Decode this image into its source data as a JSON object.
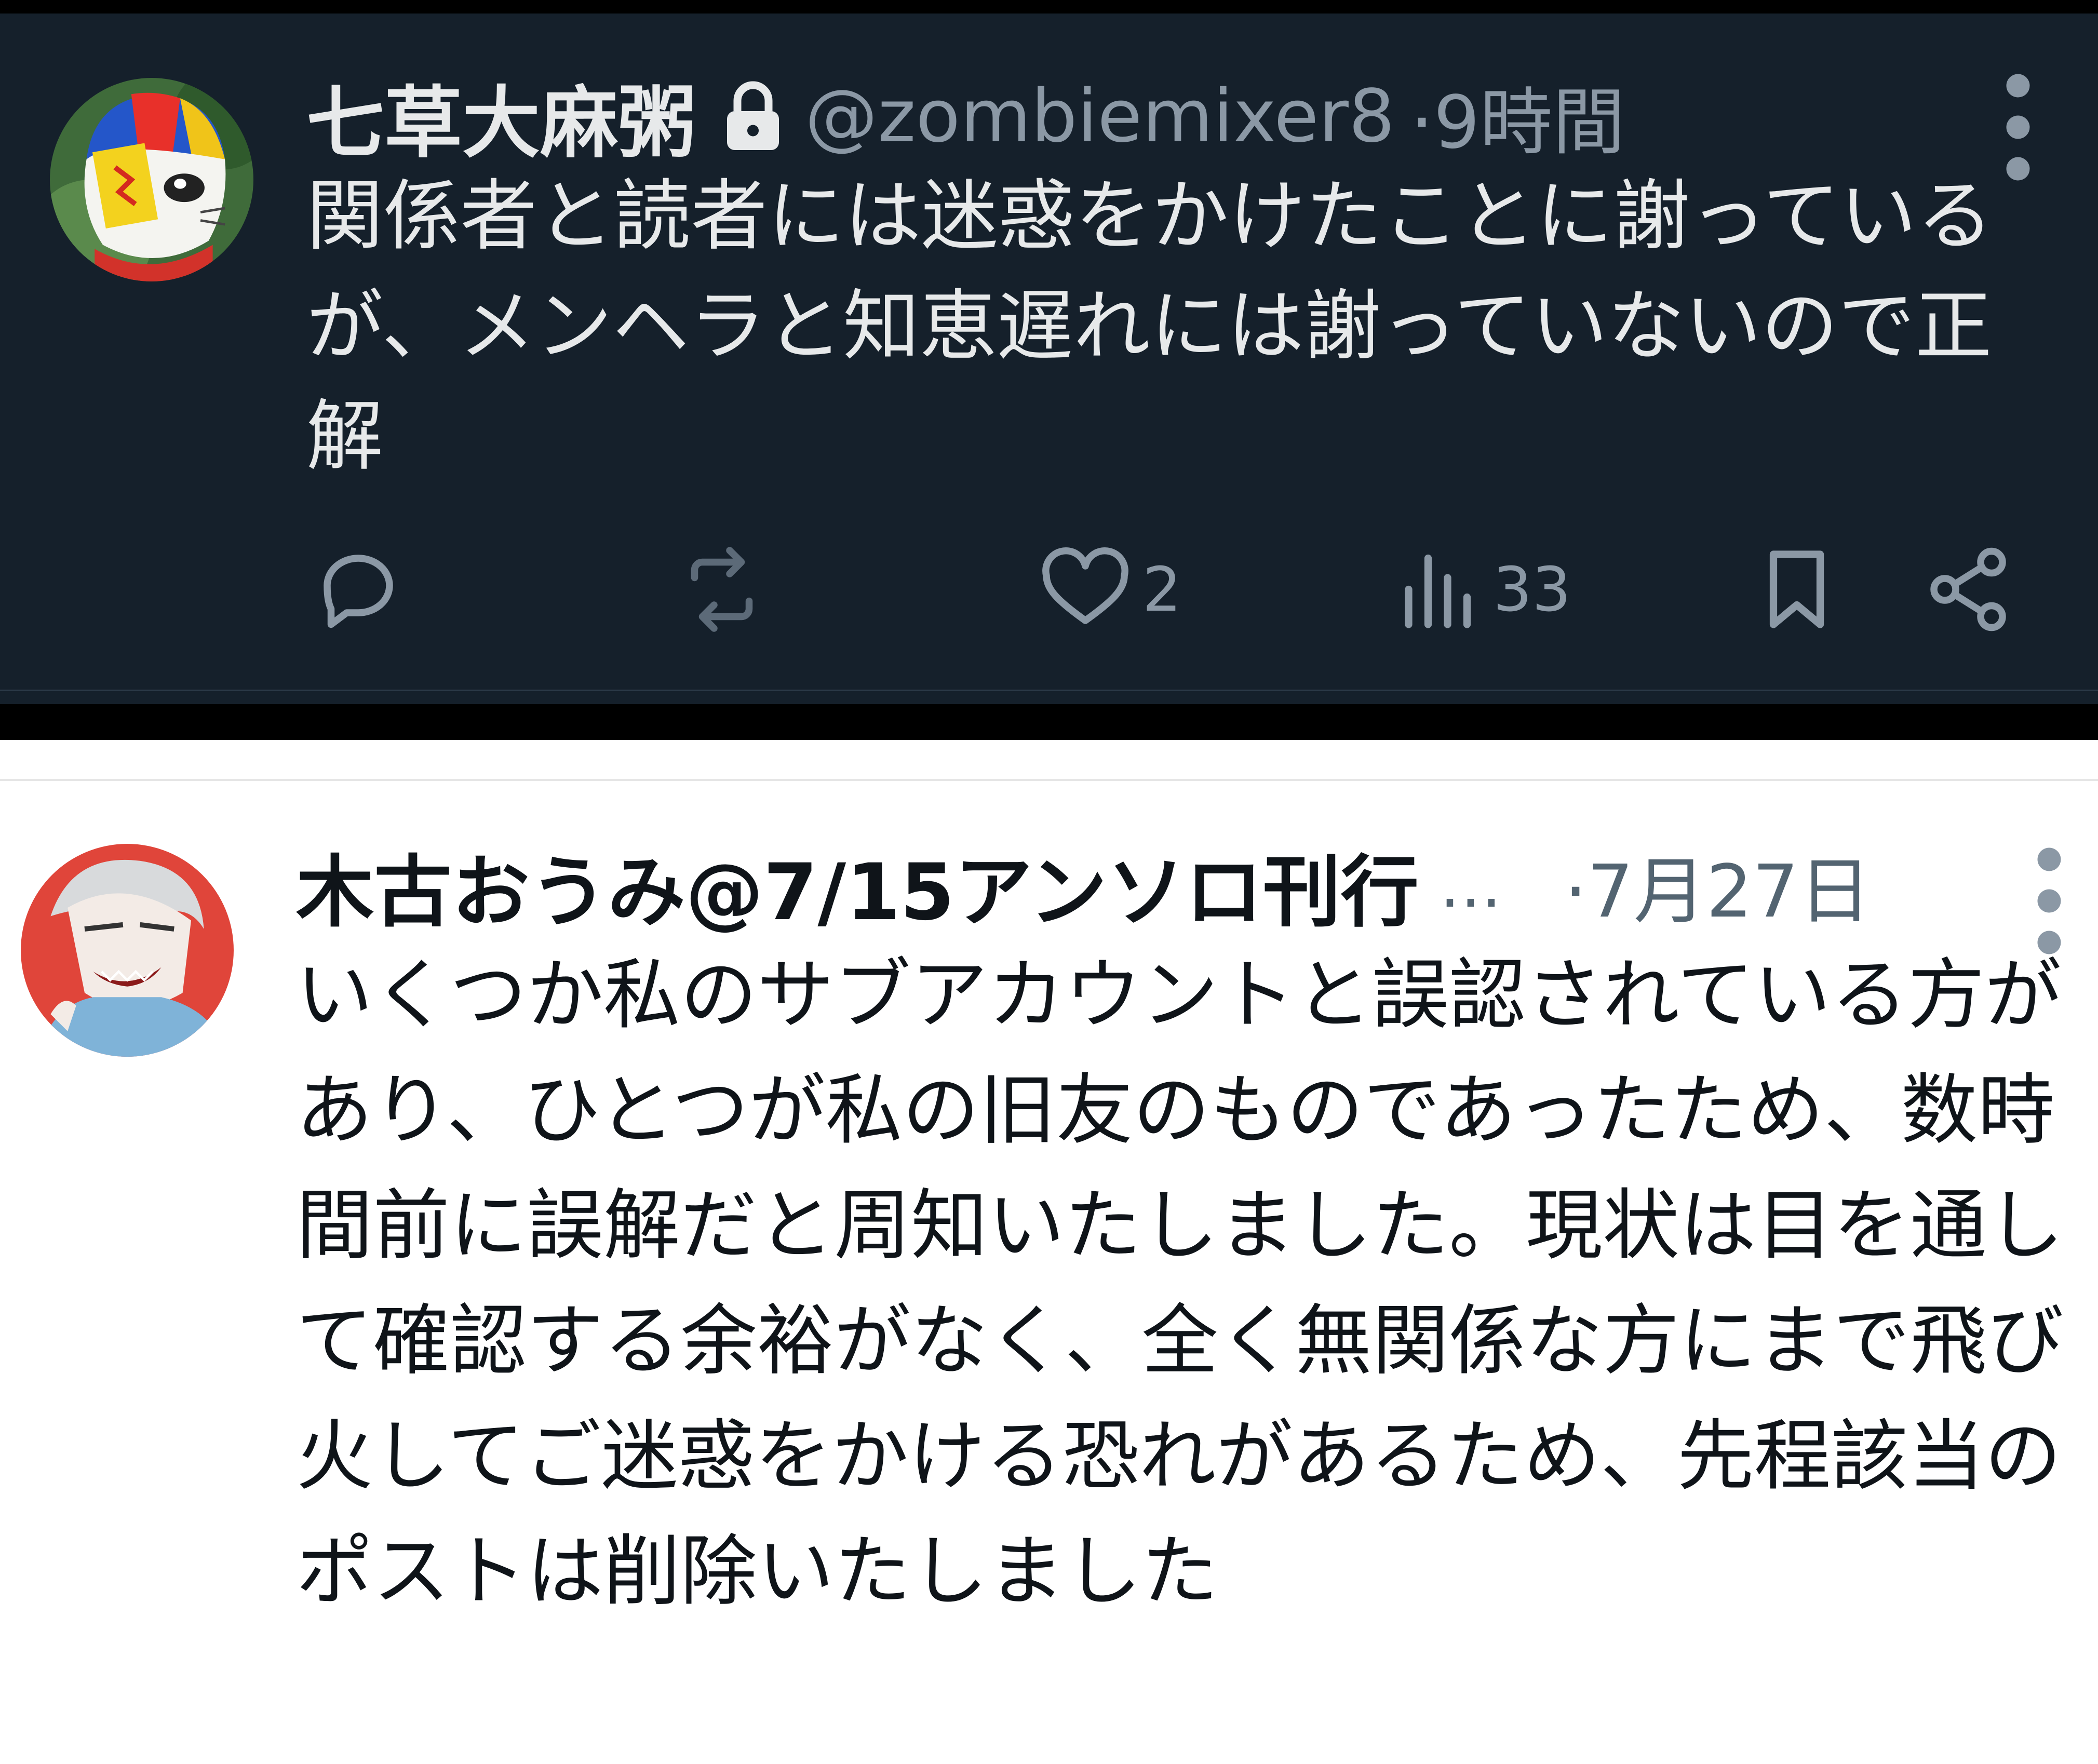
{
  "tweet_dark": {
    "display_name": "七草大麻粥",
    "handle": "@zombiemixer8",
    "time": "·9時間",
    "body": "関係者と読者には迷惑をかけたことに謝っているが、メンヘラと知恵遅れには謝っていないので正解",
    "actions": {
      "reply_count": "",
      "retweet_count": "",
      "like_count": "2",
      "views_count": "33"
    },
    "icons": {
      "lock": "lock-icon",
      "more": "more-vertical-icon",
      "reply": "reply-icon",
      "retweet": "retweet-icon",
      "like": "heart-icon",
      "views": "views-icon",
      "bookmark": "bookmark-icon",
      "share": "share-icon"
    }
  },
  "tweet_light": {
    "display_name": "木古おうみ@7/15アンソロ刊行",
    "ellipsis": "…",
    "time": "·7月27日",
    "body": "いくつか私のサブアカウントと誤認されている方があり、ひとつが私の旧友のものであったため、数時間前に誤解だと周知いたしました。現状は目を通して確認する余裕がなく、全く無関係な方にまで飛び火してご迷惑をかける恐れがあるため、先程該当のポストは削除いたしました",
    "icons": {
      "more": "more-vertical-icon"
    }
  },
  "colors": {
    "dark_bg": "#15202b",
    "dark_text": "#e7e9ea",
    "dark_secondary": "#8b98a5",
    "light_bg": "#ffffff",
    "light_text": "#0f1419",
    "light_secondary": "#536471"
  }
}
